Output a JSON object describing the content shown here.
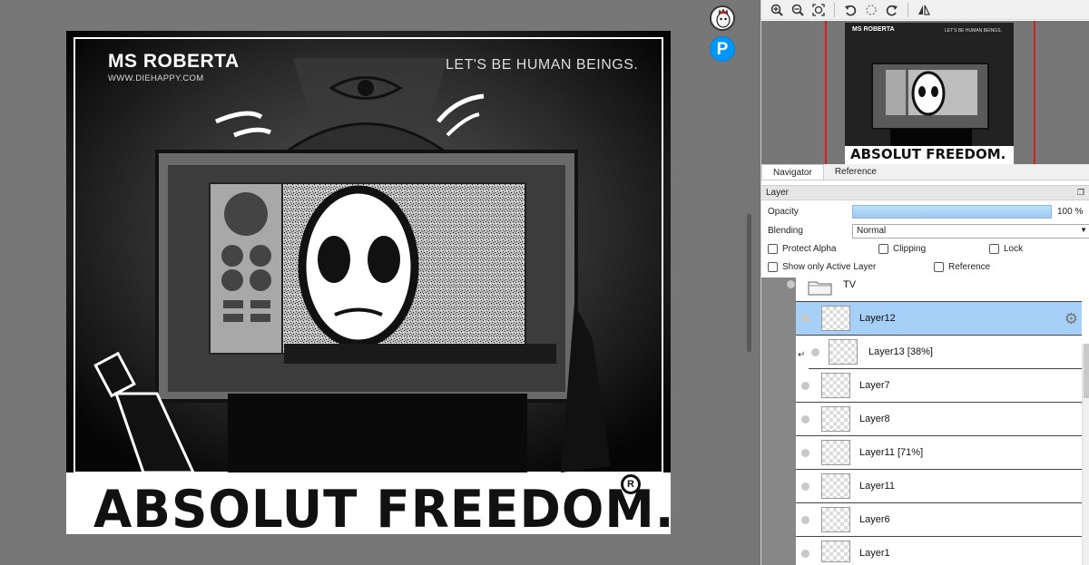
{
  "artwork": {
    "brand": "MS ROBERTA",
    "url": "WWW.DIEHAPPY.COM",
    "slogan": "LET'S BE HUMAN BEINGS.",
    "footer": "ABSOLUT FREEDOM.",
    "reg_mark": "R"
  },
  "floating": {
    "pixiv_label": "P"
  },
  "toolbar": {
    "icons": [
      "zoom-in-icon",
      "zoom-out-icon",
      "fit-icon",
      "rotate-left-icon",
      "reset-rotation-icon",
      "rotate-right-icon",
      "flip-icon"
    ]
  },
  "navigator_thumb": {
    "brand": "MS ROBERTA",
    "slogan": "LET'S BE HUMAN BEINGS.",
    "footer": "ABSOLUT FREEDOM."
  },
  "panel_tabs": {
    "navigator": "Navigator",
    "reference": "Reference"
  },
  "layer_panel": {
    "title": "Layer",
    "opacity_label": "Opacity",
    "opacity_value": "100 %",
    "opacity_level": 1.0,
    "blending_label": "Blending",
    "blending_value": "Normal",
    "protect_alpha": "Protect Alpha",
    "clipping": "Clipping",
    "lock": "Lock",
    "show_only_active": "Show only Active Layer",
    "reference": "Reference"
  },
  "layers": [
    {
      "name": "TV",
      "type": "folder"
    },
    {
      "name": "Layer12",
      "selected": true
    },
    {
      "name": "Layer13 [38%]",
      "clipped": true
    },
    {
      "name": "Layer7"
    },
    {
      "name": "Layer8"
    },
    {
      "name": "Layer11 [71%]"
    },
    {
      "name": "Layer11"
    },
    {
      "name": "Layer6"
    },
    {
      "name": "Layer1"
    }
  ],
  "colors": {
    "selected_layer": "#a6d0f7",
    "pixiv_blue": "#0096fa",
    "navigator_frame": "#d21e1e"
  }
}
